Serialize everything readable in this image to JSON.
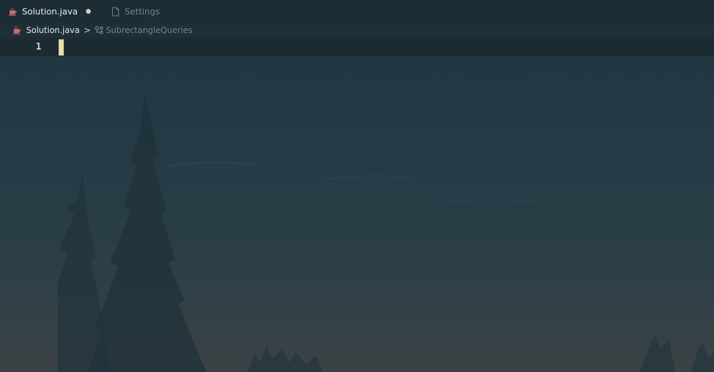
{
  "tabs": [
    {
      "label": "Solution.java",
      "icon": "java-coffee-icon",
      "active": true,
      "modified": true
    },
    {
      "label": "Settings",
      "icon": "file-icon",
      "active": false
    }
  ],
  "breadcrumb": {
    "file": "Solution.java",
    "separator": ">",
    "symbol": "SubrectangleQueries",
    "symbol_icon": "class-symbol-icon"
  },
  "editor": {
    "line_numbers": [
      "1"
    ],
    "current_line": "1"
  },
  "colors": {
    "tab_bar": "#1d2d35",
    "editor_bg": "#233944",
    "cursor": "#e9dfb8",
    "java_icon": "#c86d6d"
  }
}
